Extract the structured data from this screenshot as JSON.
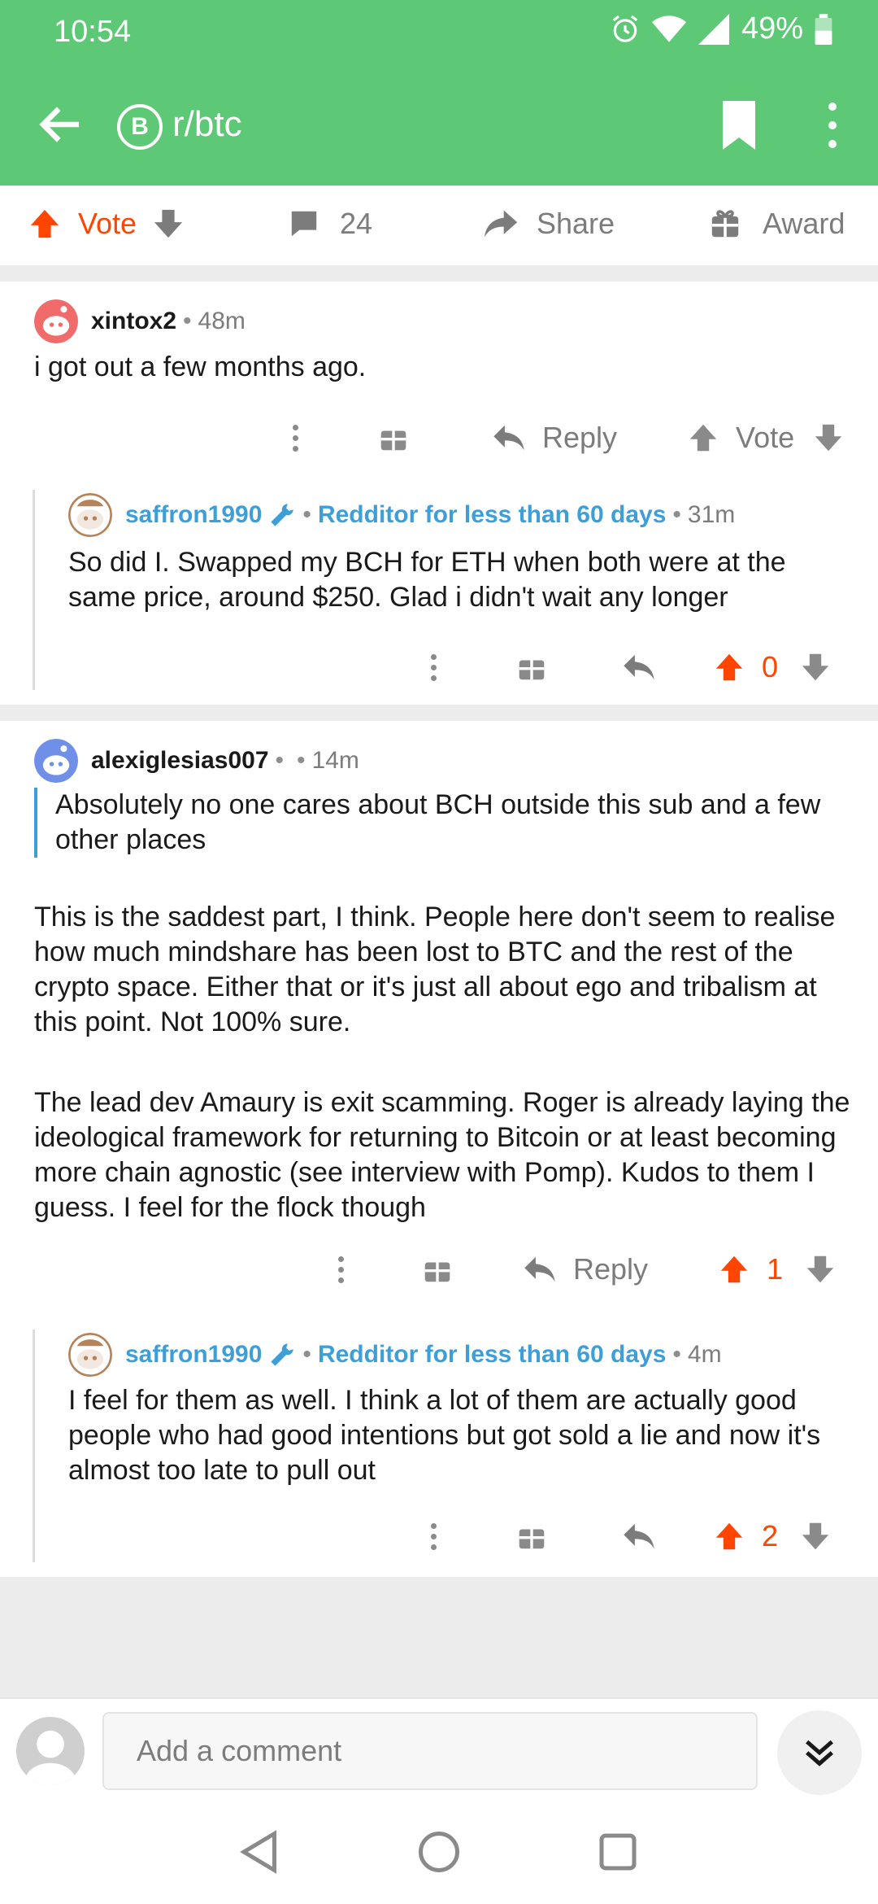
{
  "status_bar": {
    "time": "10:54",
    "battery": "49%"
  },
  "app_bar": {
    "subreddit": "r/btc",
    "sub_icon_glyph": "B"
  },
  "action_bar": {
    "vote_label": "Vote",
    "comments_count": "24",
    "share_label": "Share",
    "award_label": "Award"
  },
  "comments": [
    {
      "author": "xintox2",
      "age": "48m",
      "body": "i got out a few months ago.",
      "reply_label": "Reply",
      "vote_label": "Vote"
    },
    {
      "author": "saffron1990",
      "flair": "Redditor for less than 60 days",
      "age": "31m",
      "body": "So did I. Swapped my BCH for ETH when both were at the same price, around $250. Glad i didn't wait any longer",
      "score": "0"
    },
    {
      "author": "alexiglesias007",
      "age": "14m",
      "quote": "Absolutely no one cares about BCH outside this sub and a few other places",
      "paragraph1": "This is the saddest part, I think. People here don't seem to realise how much mindshare has been lost to BTC and the rest of the crypto space. Either that or it's just all about ego and tribalism at this point. Not 100% sure.",
      "paragraph2": "The lead dev Amaury is exit scamming. Roger is already laying the ideological framework for returning to Bitcoin or at least becoming more chain agnostic (see interview with Pomp). Kudos to them I guess. I feel for the flock though",
      "reply_label": "Reply",
      "score": "1"
    },
    {
      "author": "saffron1990",
      "flair": "Redditor for less than 60 days",
      "age": "4m",
      "body": "I feel for them as well. I think a lot of them are actually good people who had good intentions but got sold a lie and now it's almost too late to pull out",
      "score": "2"
    }
  ],
  "comment_bar": {
    "placeholder": "Add a comment"
  },
  "colors": {
    "header": "#5dc976",
    "upvote": "#ff4500",
    "flair": "#3e9fd8"
  }
}
